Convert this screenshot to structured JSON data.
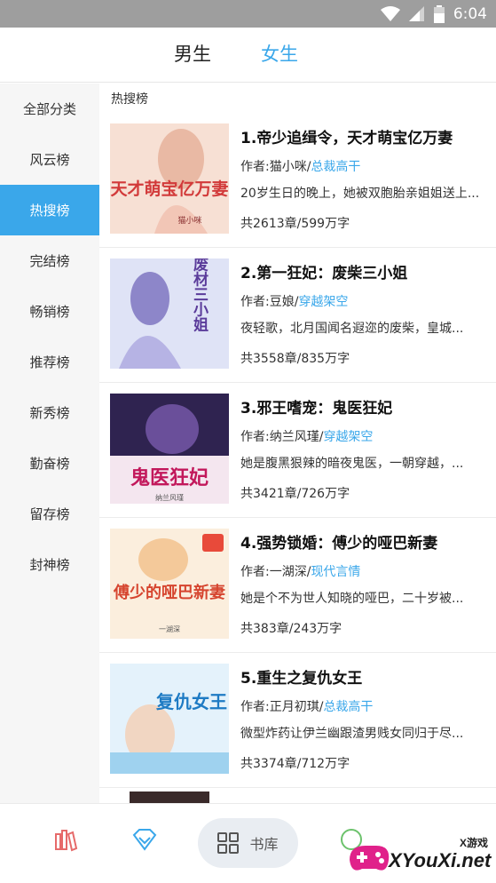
{
  "status_bar": {
    "time": "6:04"
  },
  "gender_tabs": [
    {
      "label": "男生"
    },
    {
      "label": "女生"
    }
  ],
  "sidebar": {
    "items": [
      {
        "label": "全部分类"
      },
      {
        "label": "风云榜"
      },
      {
        "label": "热搜榜"
      },
      {
        "label": "完结榜"
      },
      {
        "label": "畅销榜"
      },
      {
        "label": "推荐榜"
      },
      {
        "label": "新秀榜"
      },
      {
        "label": "勤奋榜"
      },
      {
        "label": "留存榜"
      },
      {
        "label": "封神榜"
      }
    ],
    "active_index": 2
  },
  "list": {
    "section_title": "热搜榜",
    "books": [
      {
        "title": "1.帝少追缉令，天才萌宝亿万妻",
        "author": "作者:猫小咪/",
        "category": "总裁高干",
        "desc": "20岁生日的晚上，她被双胞胎亲姐姐送上...",
        "stats": "共2613章/599万字",
        "cover_text": "天才萌宝亿万妻",
        "cover_author": "猫小咪",
        "cover_color": "#f3d6c8"
      },
      {
        "title": "2.第一狂妃：废柴三小姐",
        "author": "作者:豆娘/",
        "category": "穿越架空",
        "desc": "夜轻歌，北月国闻名遐迩的废柴，皇城...",
        "stats": "共3558章/835万字",
        "cover_text": "废材三小姐",
        "cover_author": "",
        "cover_color": "#c9cfee"
      },
      {
        "title": "3.邪王嗜宠：鬼医狂妃",
        "author": "作者:纳兰风瑾/",
        "category": "穿越架空",
        "desc": "她是腹黑狠辣的暗夜鬼医，一朝穿越，...",
        "stats": "共3421章/726万字",
        "cover_text": "鬼医狂妃",
        "cover_author": "纳兰风瑾",
        "cover_color": "#3b2a5e"
      },
      {
        "title": "4.强势锁婚：傅少的哑巴新妻",
        "author": "作者:一湖深/",
        "category": "现代言情",
        "desc": "她是个不为世人知晓的哑巴，二十岁被...",
        "stats": "共383章/243万字",
        "cover_text": "傅少的哑巴新妻",
        "cover_author": "一湖深",
        "cover_color": "#f7e7d2"
      },
      {
        "title": "5.重生之复仇女王",
        "author": "作者:正月初琪/",
        "category": "总裁高干",
        "desc": "微型炸药让伊兰幽跟渣男贱女同归于尽...",
        "stats": "共3374章/712万字",
        "cover_text": "复仇女王",
        "cover_author": "",
        "cover_color": "#dbeefa"
      }
    ]
  },
  "bottom_nav": {
    "library_label": "书库"
  },
  "watermark": {
    "text": "XYouXi.net",
    "small": "X游戏"
  },
  "colors": {
    "accent": "#3aa7ea",
    "nav_icon": "#e66a6a"
  }
}
